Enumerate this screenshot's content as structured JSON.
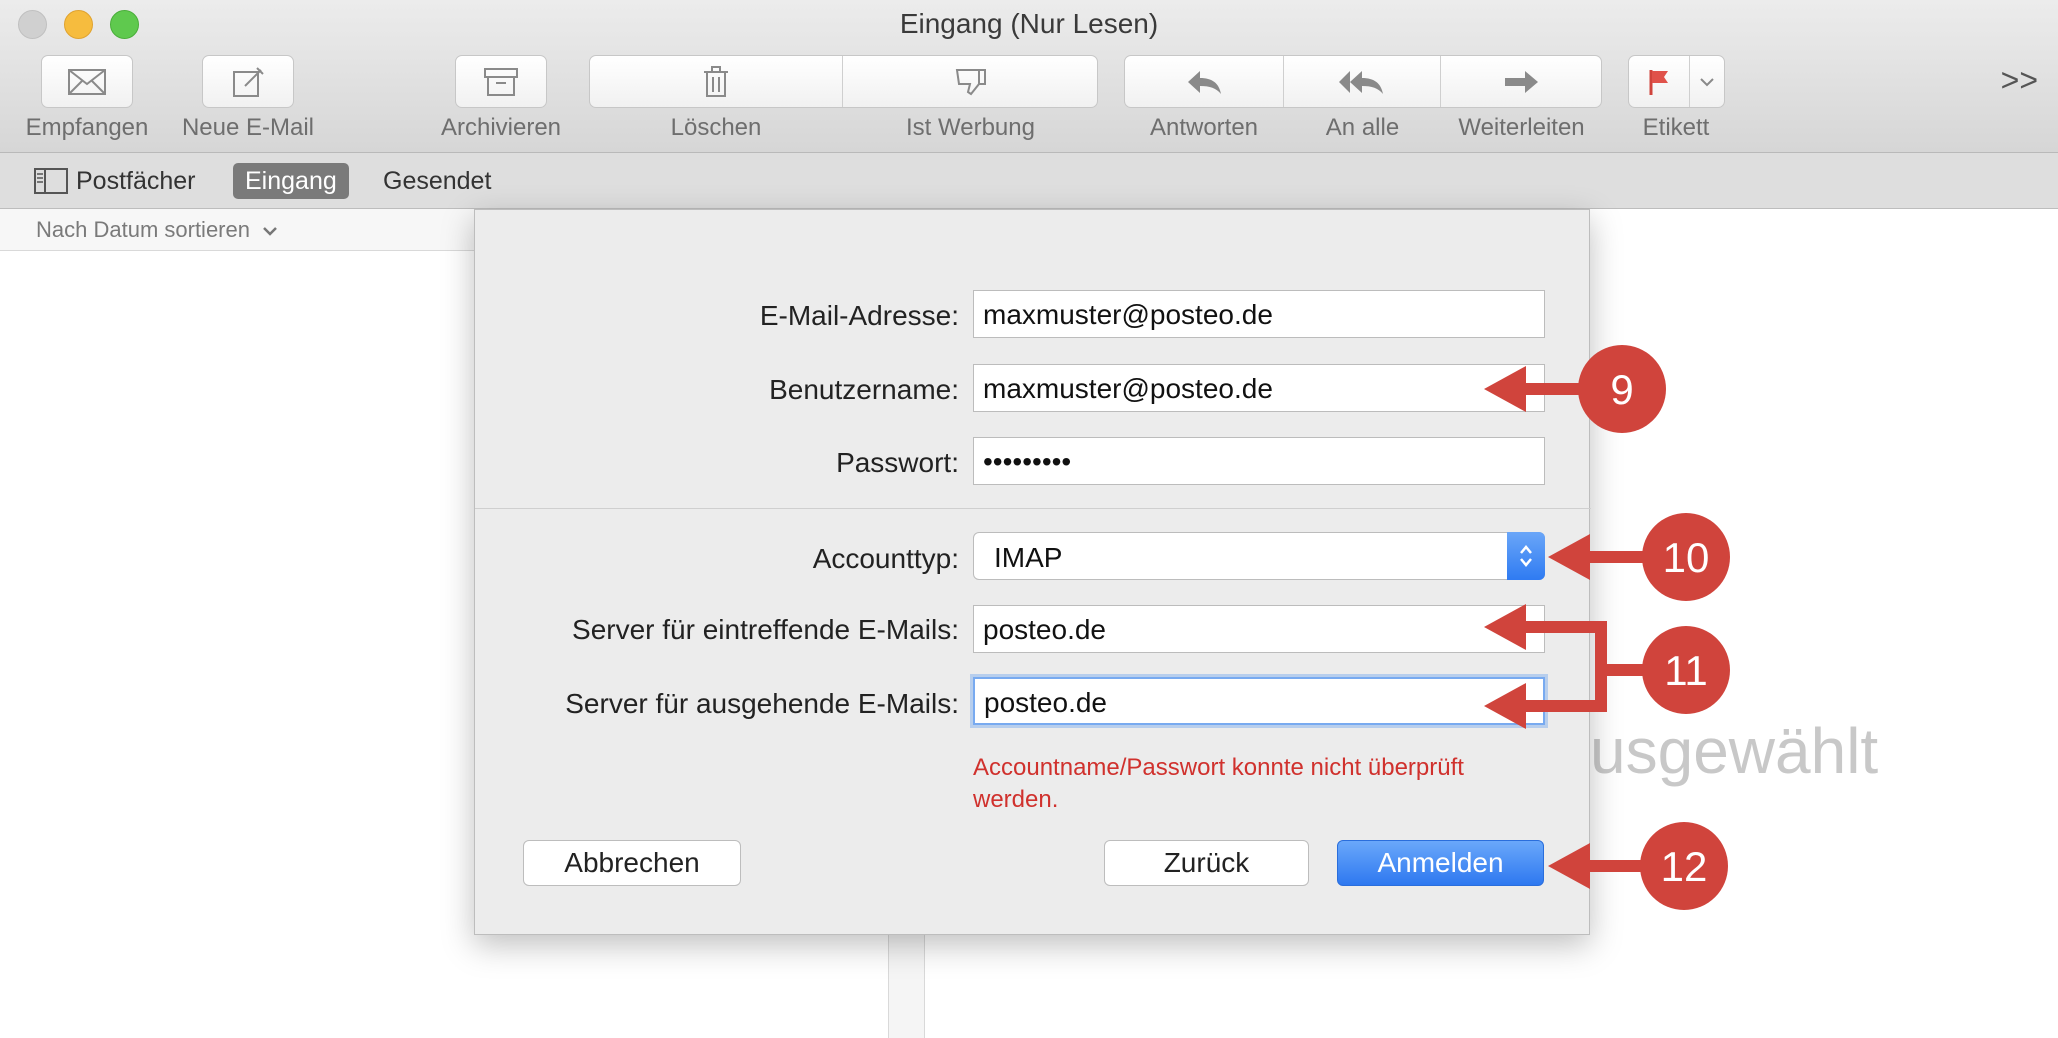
{
  "window": {
    "title": "Eingang (Nur Lesen)"
  },
  "toolbar": {
    "get_mail": "Empfangen",
    "new_mail": "Neue E-Mail",
    "archive": "Archivieren",
    "delete": "Löschen",
    "junk": "Ist Werbung",
    "reply": "Antworten",
    "reply_all": "An alle",
    "forward": "Weiterleiten",
    "flag": "Etikett",
    "more": ">>"
  },
  "favorites": {
    "mailboxes": "Postfächer",
    "inbox": "Eingang",
    "sent": "Gesendet"
  },
  "message_list": {
    "sort_label": "Nach Datum sortieren"
  },
  "preview": {
    "empty_text": "usgewählt"
  },
  "dialog": {
    "email_label": "E-Mail-Adresse:",
    "email_value": "maxmuster@posteo.de",
    "username_label": "Benutzername:",
    "username_value": "maxmuster@posteo.de",
    "password_label": "Passwort:",
    "password_value": "•••••••••",
    "account_type_label": "Accounttyp:",
    "account_type_value": "IMAP",
    "incoming_label": "Server für eintreffende E-Mails:",
    "incoming_value": "posteo.de",
    "outgoing_label": "Server für ausgehende E-Mails:",
    "outgoing_value": "posteo.de",
    "error": "Accountname/Passwort konnte nicht überprüft werden.",
    "cancel": "Abbrechen",
    "back": "Zurück",
    "sign_in": "Anmelden"
  },
  "annotations": {
    "badges": [
      "9",
      "10",
      "11",
      "12"
    ],
    "color": "#d0443c"
  }
}
